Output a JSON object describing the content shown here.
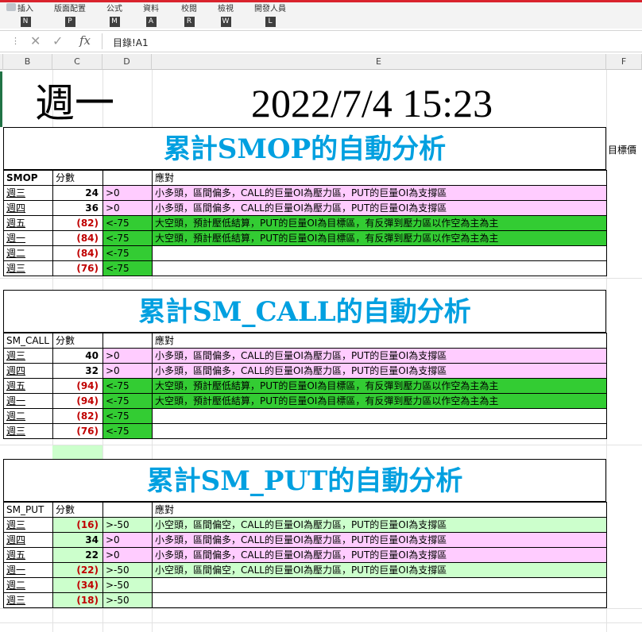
{
  "ribbon": {
    "tabs": [
      {
        "label": "插入",
        "key": "N"
      },
      {
        "label": "版面配置",
        "key": "P"
      },
      {
        "label": "公式",
        "key": "M"
      },
      {
        "label": "資料",
        "key": "A"
      },
      {
        "label": "校閱",
        "key": "R"
      },
      {
        "label": "檢視",
        "key": "W"
      },
      {
        "label": "開發人員",
        "key": "L"
      }
    ]
  },
  "formula_bar": {
    "cancel_icon": "x-icon",
    "enter_icon": "check-icon",
    "fx_label": "fx",
    "formula": "目錄!A1"
  },
  "columns": [
    "B",
    "C",
    "D",
    "E",
    "F"
  ],
  "header_block": {
    "day": "週一",
    "datetime": "2022/7/4 15:23"
  },
  "side_label": "目標價",
  "sections": [
    {
      "title": "累計SMOP的自動分析",
      "col1": "SMOP",
      "col2": "分數",
      "col3": "",
      "col4": "應對",
      "rows": [
        {
          "day": "週三",
          "score": "24",
          "cond": ">0",
          "note": "小多頭，區間偏多，CALL的巨量OI為壓力區，PUT的巨量OI為支撐區",
          "style": "pink",
          "neg": false
        },
        {
          "day": "週四",
          "score": "36",
          "cond": ">0",
          "note": "小多頭，區間偏多，CALL的巨量OI為壓力區，PUT的巨量OI為支撐區",
          "style": "pink",
          "neg": false
        },
        {
          "day": "週五",
          "score": "(82)",
          "cond": "<-75",
          "note": "大空頭，預計壓低結算，PUT的巨量OI為目標區，有反彈到壓力區以作空為主為主",
          "style": "green",
          "neg": true
        },
        {
          "day": "週一",
          "score": "(84)",
          "cond": "<-75",
          "note": "大空頭，預計壓低結算，PUT的巨量OI為目標區，有反彈到壓力區以作空為主為主",
          "style": "green",
          "neg": true
        },
        {
          "day": "週二",
          "score": "(84)",
          "cond": "<-75",
          "note": "",
          "style": "green",
          "neg": true
        },
        {
          "day": "週三",
          "score": "(76)",
          "cond": "<-75",
          "note": "",
          "style": "green",
          "neg": true
        }
      ]
    },
    {
      "title": "累計SM_CALL的自動分析",
      "col1": "SM_CALL",
      "col2": "分數",
      "col3": "",
      "col4": "應對",
      "rows": [
        {
          "day": "週三",
          "score": "40",
          "cond": ">0",
          "note": "小多頭，區間偏多，CALL的巨量OI為壓力區，PUT的巨量OI為支撐區",
          "style": "pink",
          "neg": false
        },
        {
          "day": "週四",
          "score": "32",
          "cond": ">0",
          "note": "小多頭，區間偏多，CALL的巨量OI為壓力區，PUT的巨量OI為支撐區",
          "style": "pink",
          "neg": false
        },
        {
          "day": "週五",
          "score": "(94)",
          "cond": "<-75",
          "note": "大空頭，預計壓低結算，PUT的巨量OI為目標區，有反彈到壓力區以作空為主為主",
          "style": "green",
          "neg": true
        },
        {
          "day": "週一",
          "score": "(94)",
          "cond": "<-75",
          "note": "大空頭，預計壓低結算，PUT的巨量OI為目標區，有反彈到壓力區以作空為主為主",
          "style": "green",
          "neg": true
        },
        {
          "day": "週二",
          "score": "(82)",
          "cond": "<-75",
          "note": "",
          "style": "green",
          "neg": true
        },
        {
          "day": "週三",
          "score": "(76)",
          "cond": "<-75",
          "note": "",
          "style": "green",
          "neg": true
        }
      ]
    },
    {
      "title": "累計SM_PUT的自動分析",
      "col1": "SM_PUT",
      "col2": "分數",
      "col3": "",
      "col4": "應對",
      "rows": [
        {
          "day": "週三",
          "score": "(16)",
          "cond": ">-50",
          "note": "小空頭，區間偏空，CALL的巨量OI為壓力區，PUT的巨量OI為支撐區",
          "style": "lgreen",
          "neg": true
        },
        {
          "day": "週四",
          "score": "34",
          "cond": ">0",
          "note": "小多頭，區間偏多，CALL的巨量OI為壓力區，PUT的巨量OI為支撐區",
          "style": "pink",
          "neg": false
        },
        {
          "day": "週五",
          "score": "22",
          "cond": ">0",
          "note": "小多頭，區間偏多，CALL的巨量OI為壓力區，PUT的巨量OI為支撐區",
          "style": "pink",
          "neg": false
        },
        {
          "day": "週一",
          "score": "(22)",
          "cond": ">-50",
          "note": "小空頭，區間偏空，CALL的巨量OI為壓力區，PUT的巨量OI為支撐區",
          "style": "lgreen",
          "neg": true
        },
        {
          "day": "週二",
          "score": "(34)",
          "cond": ">-50",
          "note": "",
          "style": "lgreen",
          "neg": true
        },
        {
          "day": "週三",
          "score": "(18)",
          "cond": ">-50",
          "note": "",
          "style": "lgreen",
          "neg": true
        }
      ]
    }
  ],
  "colors": {
    "pink": "#ffccff",
    "green": "#33cc33",
    "light_green": "#ccffcc",
    "negative": "#c00000",
    "title": "#00a0e0"
  }
}
